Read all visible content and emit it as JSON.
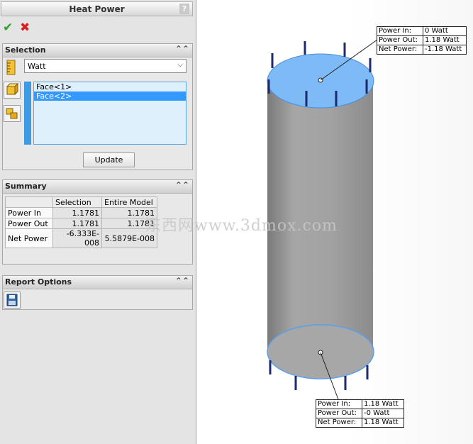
{
  "panel": {
    "title": "Heat Power",
    "help": "?",
    "ok_glyph": "✔",
    "cancel_glyph": "✖",
    "ok_color": "#2ba02b",
    "cancel_color": "#d82020"
  },
  "selection": {
    "header": "Selection",
    "units": "Watt",
    "faces": [
      "Face<1>",
      "Face<2>"
    ],
    "selected_index": 1,
    "update_label": "Update"
  },
  "summary": {
    "header": "Summary",
    "columns": [
      "",
      "Selection",
      "Entire Model"
    ],
    "rows": [
      {
        "label": "Power In",
        "selection": "1.1781",
        "entire": "1.1781"
      },
      {
        "label": "Power Out",
        "selection": "1.1781",
        "entire": "1.1781"
      },
      {
        "label": "Net Power",
        "selection": "-6.333E-008",
        "entire": "5.5879E-008"
      }
    ]
  },
  "report": {
    "header": "Report Options"
  },
  "callouts": {
    "top": {
      "rows": [
        {
          "key": "Power In:",
          "value": "0 Watt"
        },
        {
          "key": "Power Out:",
          "value": "1.18 Watt"
        },
        {
          "key": "Net Power:",
          "value": "-1.18 Watt"
        }
      ]
    },
    "bottom": {
      "rows": [
        {
          "key": "Power In:",
          "value": "1.18 Watt"
        },
        {
          "key": "Power Out:",
          "value": "-0 Watt"
        },
        {
          "key": "Net Power:",
          "value": "1.18 Watt"
        }
      ]
    }
  },
  "watermark": "东西网www.3dmox.com",
  "colors": {
    "face_highlight": "#7dbaf6",
    "cylinder_body": "#a2a2a2",
    "arrow": "#1c2a6e"
  }
}
